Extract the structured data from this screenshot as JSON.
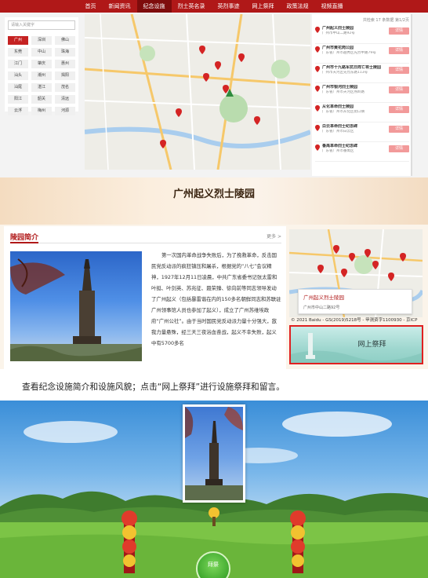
{
  "panel1": {
    "nav": [
      "首页",
      "新闻资讯",
      "纪念设施",
      "烈士英名录",
      "英烈事迹",
      "网上祭拜",
      "政策法规",
      "视频直播"
    ],
    "nav_active": 2,
    "search_placeholder": "请输入关键字",
    "cities": [
      "广州",
      "深圳",
      "佛山",
      "东莞",
      "中山",
      "珠海",
      "江门",
      "肇庆",
      "惠州",
      "汕头",
      "潮州",
      "揭阳",
      "汕尾",
      "湛江",
      "茂名",
      "阳江",
      "韶关",
      "清远",
      "云浮",
      "梅州",
      "河源"
    ],
    "city_active": 0,
    "list_count": "共检索 17 条数据 第1/2页",
    "detail_label": "详情",
    "items": [
      {
        "name": "广州起义烈士陵园",
        "addr": "广州市中山二路92号"
      },
      {
        "name": "广州市黄花岗公园",
        "addr": "广东省广州市越秀区先烈中路79号"
      },
      {
        "name": "广州市十九路军抗日阵亡将士陵园",
        "addr": "广州市天河区先烈东路113号"
      },
      {
        "name": "广州市银河烈士陵园",
        "addr": "广东省广州市天河区燕岭路"
      },
      {
        "name": "从化革命烈士陵园",
        "addr": "广东省广州市从化区街口镇"
      },
      {
        "name": "白云革命烈士纪念碑",
        "addr": "广东省广州市白云区"
      },
      {
        "name": "番禺革命烈士纪念碑",
        "addr": "广东省广州市番禺区"
      }
    ]
  },
  "panel2": {
    "title": "广州起义烈士陵园",
    "intro_title": "陵园简介",
    "more": "更多 >",
    "intro_text": "第一次国内革命战争失败后，为了挽救革命，反击国民党反动派的疯狂镇压和屠杀，根据党的“八七”会议精神，1927年12月11日凌晨，中共广东省委书记张太雷和叶挺、叶剑英、苏兆征、聂荣臻、徐向前等同志领导发动了广州起义（包括暴雷谐在内的150多名朝鲜同志和苏联驻广州领事馆人员也参加了起义），成立了广州苏维埃政府“广州公社”。由于当时国民党反动派力量十分强大，敌我力量悬殊，经三天三夜浴血奋战，起义不幸失败，起义中有5700多名",
    "popup_name": "广州起义烈士陵园",
    "popup_addr": "广州市中山二路92号",
    "map_copyright": "© 2021 Baidu - GS(2019)5218号 - 甲测资字1100930 - 京ICP",
    "tribute_label": "网上祭拜"
  },
  "caption": "查看纪念设施简介和设施风貌；点击“网上祭拜”进行设施祭拜和留言。",
  "panel3": {
    "worship_label": "拜祭"
  }
}
